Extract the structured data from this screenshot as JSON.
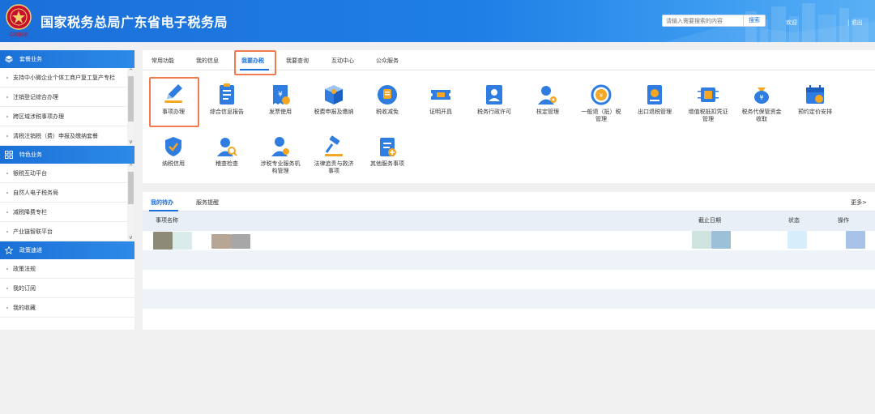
{
  "header": {
    "title": "国家税务总局广东省电子税务局",
    "emblem_caption": "中国税务",
    "search_placeholder": "请输入需要搜索的内容",
    "search_button": "搜索",
    "welcome": "欢迎",
    "logout": "| 退出"
  },
  "sidebar": {
    "groups": [
      {
        "title": "套餐业务",
        "icon": "package-icon",
        "items": [
          "支持中小微企业个体工商户复工复产专栏",
          "注销登记综合办理",
          "跨区域涉税事项办理",
          "清税注销税（费）申报及缴纳套餐"
        ]
      },
      {
        "title": "特色业务",
        "icon": "grid-icon",
        "items": [
          "银税互动平台",
          "自然人电子税务局",
          "减税降费专栏",
          "产业链智联平台"
        ]
      },
      {
        "title": "政策速递",
        "icon": "star-icon",
        "items": [
          "政策法规",
          "我的订阅",
          "我的收藏"
        ]
      }
    ]
  },
  "main": {
    "tabs": [
      "常用功能",
      "我的信息",
      "我要办税",
      "我要查询",
      "互动中心",
      "公众服务"
    ],
    "active_tab": "我要办税",
    "tiles": [
      {
        "label": "事项办理",
        "icon": "pencil-icon"
      },
      {
        "label": "综合信息报告",
        "icon": "document-icon"
      },
      {
        "label": "发票使用",
        "icon": "invoice-icon"
      },
      {
        "label": "税费申报及缴纳",
        "icon": "box-icon"
      },
      {
        "label": "税收减免",
        "icon": "coin-icon"
      },
      {
        "label": "证明开具",
        "icon": "ticket-icon"
      },
      {
        "label": "税务行政许可",
        "icon": "user-card-icon"
      },
      {
        "label": "核定管理",
        "icon": "user-gear-icon"
      },
      {
        "label": "一般退（抵）税\n管理",
        "icon": "refund-icon"
      },
      {
        "label": "出口退税管理",
        "icon": "book-icon"
      },
      {
        "label": "增值税抵扣凭证\n管理",
        "icon": "chip-icon"
      },
      {
        "label": "税务代保管资金\n收取",
        "icon": "money-bag-icon"
      },
      {
        "label": "预约定价安排",
        "icon": "calendar-icon"
      },
      {
        "label": "纳税信用",
        "icon": "shield-check-icon"
      },
      {
        "label": "稽查检查",
        "icon": "user-search-icon"
      },
      {
        "label": "涉税专业服务机\n构管理",
        "icon": "person-badge-icon"
      },
      {
        "label": "法律追责与救济\n事项",
        "icon": "gavel-icon"
      },
      {
        "label": "其他服务事项",
        "icon": "clipboard-plus-icon"
      }
    ]
  },
  "todo": {
    "tabs": [
      "我的待办",
      "服务提醒"
    ],
    "more": "更多>",
    "columns": [
      "事项名称",
      "截止日期",
      "状态",
      "操作"
    ]
  },
  "colors": {
    "header_blue": "#1b6fd8",
    "accent_blue": "#1b6fd8",
    "highlight_orange": "#f07b4e",
    "icon_blue": "#2f7de1",
    "icon_orange": "#f5a623"
  }
}
